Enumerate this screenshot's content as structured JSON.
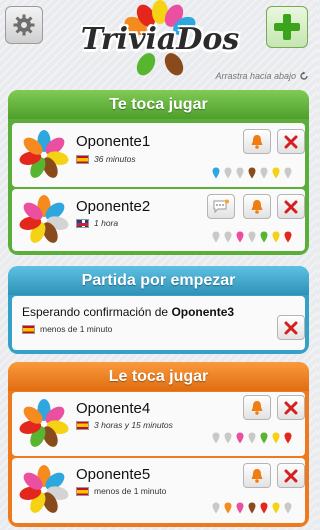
{
  "app": {
    "title": "TriviaDos",
    "pull_hint": "Arrastra hacia abajo"
  },
  "sections": {
    "my_turn": {
      "title": "Te toca jugar",
      "games": [
        {
          "opponent": "Oponente1",
          "time": "36 minutos",
          "flag": "es"
        },
        {
          "opponent": "Oponente2",
          "time": "1 hora",
          "flag": "gb"
        }
      ]
    },
    "pending": {
      "title": "Partida por empezar",
      "text": "Esperando confirmación de",
      "opponent": "Oponente3",
      "time": "menos de 1 minuto"
    },
    "their_turn": {
      "title": "Le toca jugar",
      "games": [
        {
          "opponent": "Oponente4",
          "time": "3 horas y 15 minutos",
          "flag": "es"
        },
        {
          "opponent": "Oponente5",
          "time": "menos de 1 minuto",
          "flag": "es"
        }
      ]
    }
  },
  "colors": {
    "green": "#5cae3a",
    "blue": "#36a1c6",
    "orange": "#ee7a1d",
    "category_blue": "#2ea7e0",
    "category_pink": "#ea4fa0",
    "category_brown": "#8a4b1c",
    "category_red": "#e4271d",
    "category_green": "#57b530",
    "category_yellow": "#f5d213",
    "category_orange": "#f58a1f",
    "pin_empty": "#c9c9c9"
  },
  "pins": {
    "game1": [
      "category_blue",
      "pin_empty",
      "pin_empty",
      "category_brown",
      "pin_empty",
      "category_yellow",
      "pin_empty"
    ],
    "game2": [
      "pin_empty",
      "pin_empty",
      "category_pink",
      "pin_empty",
      "category_green",
      "category_yellow",
      "category_red"
    ],
    "game4": [
      "pin_empty",
      "pin_empty",
      "category_pink",
      "pin_empty",
      "category_green",
      "category_yellow",
      "category_red"
    ],
    "game5": [
      "pin_empty",
      "category_orange",
      "category_pink",
      "category_brown",
      "category_red",
      "category_yellow",
      "pin_empty"
    ]
  }
}
